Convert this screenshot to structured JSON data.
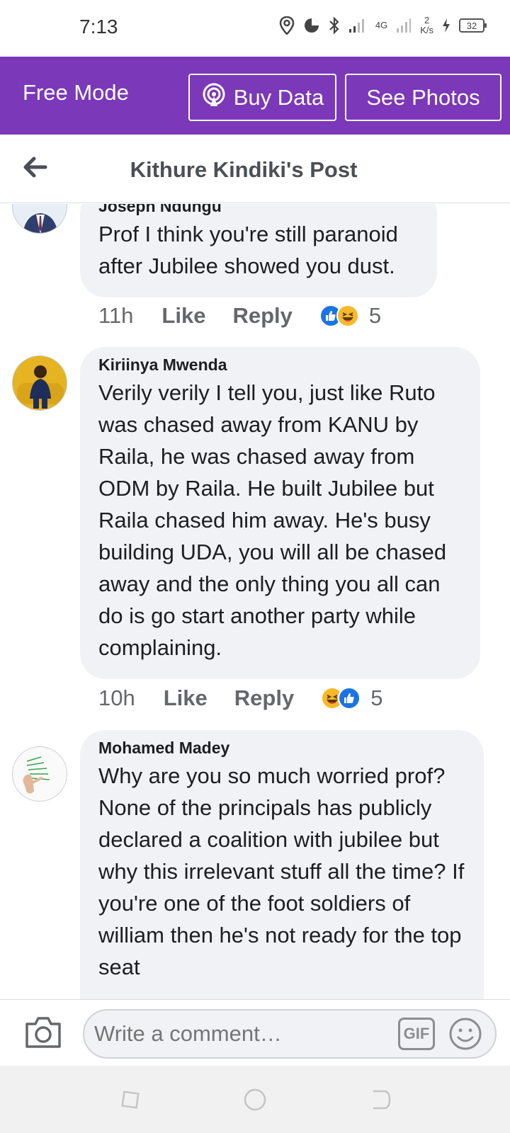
{
  "status_bar": {
    "time": "7:13",
    "network": "4G",
    "speed_value": "2",
    "speed_unit": "K/s",
    "battery": "32"
  },
  "free_bar": {
    "mode_label": "Free Mode",
    "buy_data_label": "Buy Data",
    "see_photos_label": "See Photos"
  },
  "header": {
    "title": "Kithure Kindiki's Post"
  },
  "comments": [
    {
      "author": "Joseph Ndungu",
      "text": "Prof I think you're still paranoid after Jubilee showed you dust.",
      "time": "11h",
      "like_label": "Like",
      "reply_label": "Reply",
      "reactions": [
        "like-icon",
        "haha-icon"
      ],
      "reaction_count": "5"
    },
    {
      "author": "Kiriinya Mwenda",
      "text": "Verily verily I tell you, just like Ruto was chased away from KANU by Raila, he was chased away from ODM by Raila. He built Jubilee but Raila chased him away. He's busy building UDA, you will all be chased away and the only thing you all can do is go start another party while complaining.",
      "time": "10h",
      "like_label": "Like",
      "reply_label": "Reply",
      "reactions": [
        "haha-icon",
        "like-icon"
      ],
      "reaction_count": "5"
    },
    {
      "author": "Mohamed Madey",
      "text": "Why are you so much worried prof? None of the principals has publicly declared a coalition with jubilee but why this irrelevant stuff all the time? If you're one of the foot soldiers of william then he's not ready for the top seat"
    }
  ],
  "composer": {
    "placeholder": "Write a comment…",
    "gif_label": "GIF"
  },
  "colors": {
    "brand_purple": "#7b38b8",
    "bubble_bg": "#f0f2f5",
    "like_blue": "#1b74e4",
    "haha_yellow": "#f7b928"
  }
}
